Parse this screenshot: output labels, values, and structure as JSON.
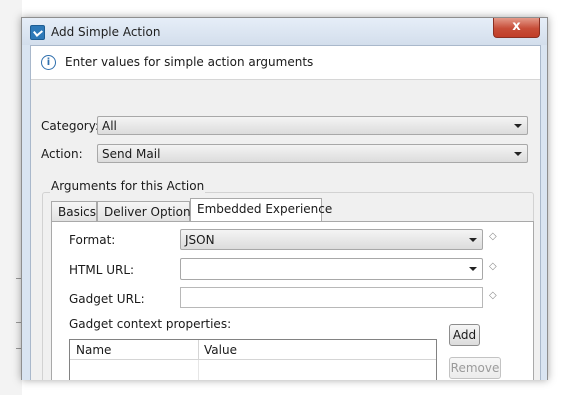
{
  "window": {
    "title": "Add Simple Action",
    "close_glyph": "x"
  },
  "message": {
    "text": "Enter values for simple action arguments",
    "icon": "info-icon"
  },
  "category": {
    "label": "Category:",
    "value": "All"
  },
  "action": {
    "label": "Action:",
    "value": "Send Mail"
  },
  "arguments_group": {
    "title": "Arguments for this Action",
    "tabs": [
      {
        "label": "Basics",
        "active": false
      },
      {
        "label": "Deliver Options",
        "active": false
      },
      {
        "label": "Embedded Experience",
        "active": true
      }
    ]
  },
  "form": {
    "format": {
      "label": "Format:",
      "value": "JSON"
    },
    "html_url": {
      "label": "HTML URL:",
      "value": ""
    },
    "gadget_url": {
      "label": "Gadget URL:",
      "value": ""
    },
    "context_properties": {
      "label": "Gadget context properties:",
      "columns": [
        "Name",
        "Value"
      ],
      "rows": []
    },
    "add_label": "Add",
    "remove_label": "Remove",
    "decoration_glyph": "◇"
  }
}
